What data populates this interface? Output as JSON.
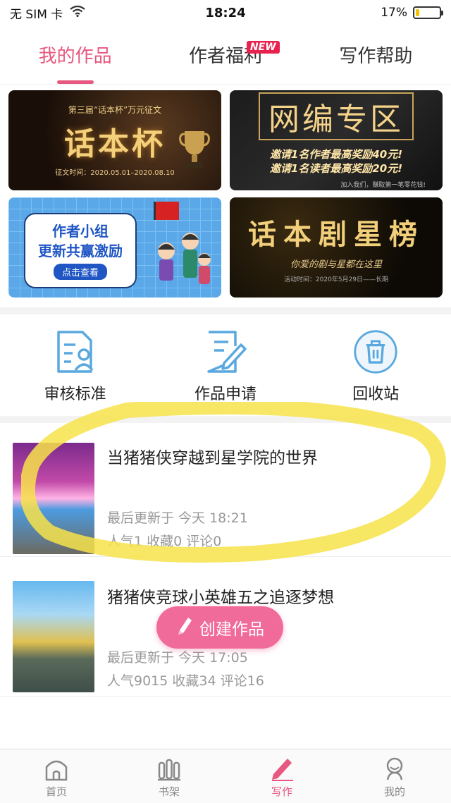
{
  "status_bar": {
    "carrier": "无 SIM 卡",
    "time": "18:24",
    "battery": "17%",
    "battery_level": 0.17
  },
  "top_tabs": [
    {
      "label": "我的作品",
      "active": true
    },
    {
      "label": "作者福利",
      "badge": "NEW"
    },
    {
      "label": "写作帮助"
    }
  ],
  "banners": {
    "b1": {
      "sub": "第三届“话本杯”万元征文",
      "title": "话本杯",
      "date": "征文时间：2020.05.01–2020.08.10"
    },
    "b2": {
      "title": "网编专区",
      "line1": "邀请1名作者最高奖励40元!",
      "line2": "邀请1名读者最高奖励20元!",
      "foot": "加入我们，赚取第一笔零花钱!"
    },
    "b3": {
      "line1": "作者小组",
      "line2": "更新共赢激励",
      "button": "点击查看"
    },
    "b4": {
      "title": "话本剧星榜",
      "sub": "你爱的剧与星都在这里",
      "foot": "活动时间：2020年5月29日——长期"
    }
  },
  "actions": [
    {
      "label": "审核标准",
      "icon": "review-standard-icon"
    },
    {
      "label": "作品申请",
      "icon": "work-apply-icon"
    },
    {
      "label": "回收站",
      "icon": "trash-icon"
    }
  ],
  "works": [
    {
      "title": "当猪猪侠穿越到星学院的世界",
      "updated": "最后更新于 今天 18:21",
      "stats": "人气1 收藏0 评论0"
    },
    {
      "title": "猪猪侠竞球小英雄五之追逐梦想",
      "updated": "最后更新于 今天 17:05",
      "stats": "人气9015 收藏34 评论16"
    }
  ],
  "create_button": {
    "label": "创建作品"
  },
  "bottom_nav": [
    {
      "label": "首页",
      "icon": "home-icon"
    },
    {
      "label": "书架",
      "icon": "bookshelf-icon"
    },
    {
      "label": "写作",
      "icon": "pen-icon",
      "active": true
    },
    {
      "label": "我的",
      "icon": "profile-icon"
    }
  ],
  "colors": {
    "accent": "#e7577f",
    "create_button": "#f06b9a",
    "highlight": "#f7e24a",
    "action_icon": "#5aa8e0"
  }
}
